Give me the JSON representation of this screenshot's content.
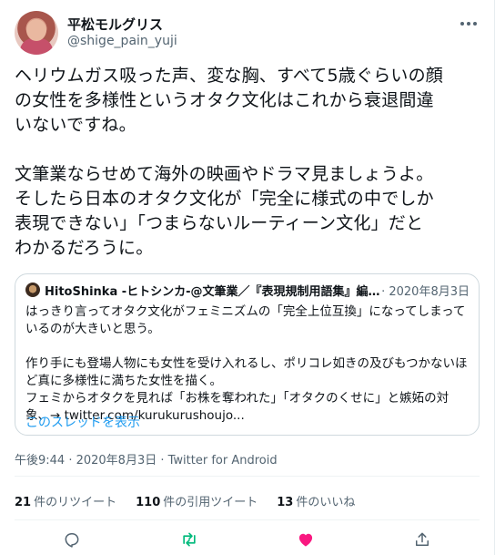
{
  "user": {
    "display_name": "平松モルグリス",
    "handle": "@shige_pain_yuji"
  },
  "tweet": {
    "text": "ヘリウムガス吸った声、変な胸、すべて5歳ぐらいの顔\nの女性を多様性というオタク文化はこれから衰退間違\nいないですね。\n\n文筆業ならせめて海外の映画やドラマ見ましょうよ。\nそしたら日本のオタク文化が「完全に様式の中でしか\n表現できない」「つまらないルーティーン文化」だと\nわかるだろうに。"
  },
  "quote": {
    "name": "HitoShinka -ヒトシンカ-@文筆業／『表現規制用語集』編...",
    "date": "· 2020年8月3日",
    "text": "はっきり言ってオタク文化がフェミニズムの「完全上位互換」になってしまって\nいるのが大きいと思う。\n\n作り手にも登場人物にも女性を受け入れるし、ポリコレ如きの及びもつかないほ\nど真に多様性に満ちた女性を描く。\nフェミからオタクを見れば「お株を奪われた」「オタクのくせに」と嫉妬の対\n象、→ twitter.com/kurukurushoujo...",
    "thread_link": "このスレッドを表示"
  },
  "meta": {
    "time": "午後9:44 · 2020年8月3日 · ",
    "app": "Twitter for Android"
  },
  "stats": {
    "retweets_count": "21",
    "retweets_label": "件のリツイート",
    "quotes_count": "110",
    "quotes_label": "件の引用ツイート",
    "likes_count": "13",
    "likes_label": "件のいいね"
  },
  "colors": {
    "like": "#f91880",
    "retweet": "#00ba7c",
    "link": "#1d9bf0",
    "muted": "#536471"
  },
  "icons": {
    "more": "more-horizontal-icon",
    "reply": "reply-icon",
    "retweet": "retweet-icon",
    "like": "heart-icon",
    "share": "share-icon"
  }
}
